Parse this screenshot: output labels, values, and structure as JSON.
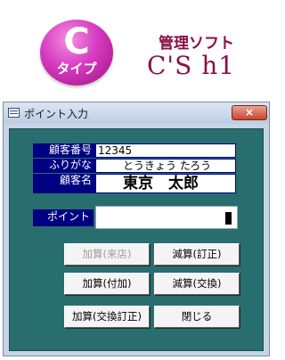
{
  "header": {
    "badge_letter": "C",
    "badge_type": "タイプ",
    "product_subtitle": "管理ソフト",
    "logo_text": "C'S h1"
  },
  "window": {
    "title": "ポイント入力",
    "close_glyph": "×"
  },
  "form": {
    "customer_number": {
      "label": "顧客番号",
      "value": "12345"
    },
    "furigana": {
      "label": "ふりがな",
      "value": "とうきょう たろう"
    },
    "customer_name": {
      "label": "顧客名",
      "value": "東京　太郎"
    },
    "points": {
      "label": "ポイント",
      "value": ""
    }
  },
  "buttons": {
    "add_not_visited": "加算(来店)",
    "subtract_correction": "減算(訂正)",
    "add_grant": "加算(付加)",
    "subtract_exchange": "減算(交換)",
    "add_exchange_correction": "加算(交換訂正)",
    "close": "閉じる"
  }
}
